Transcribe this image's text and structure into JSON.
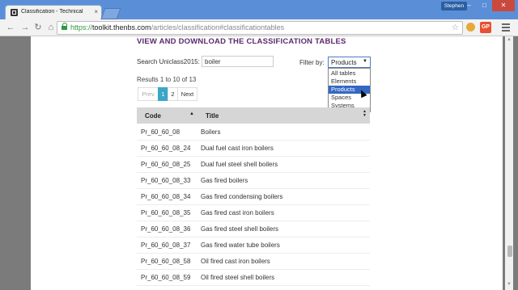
{
  "browser": {
    "tab_title": "Classification - Technical",
    "tab_close": "×",
    "user": "Stephen",
    "url_scheme": "https://",
    "url_host": "toolkit.thenbs.com",
    "url_path": "/articles/classification#classificationtables",
    "ext2_label": "GP",
    "back_icon": "arrow-left",
    "forward_icon": "arrow-right",
    "reload_icon": "reload",
    "home_icon": "home"
  },
  "page": {
    "heading": "VIEW AND DOWNLOAD THE CLASSIFICATION TABLES",
    "search_label": "Search Uniclass2015:",
    "search_value": "boiler",
    "filter_label": "Filter by:",
    "filter_selected": "Products",
    "filter_options": [
      "All tables",
      "Elements",
      "Products",
      "Spaces",
      "Systems"
    ],
    "results_text": "Results 1 to 10 of 13",
    "pager": {
      "prev": "Prev",
      "page1": "1",
      "page2": "2",
      "next": "Next"
    },
    "columns": {
      "code": "Code",
      "title": "Title"
    },
    "rows": [
      {
        "code": "Pr_60_60_08",
        "title": "Boilers"
      },
      {
        "code": "Pr_60_60_08_24",
        "title": "Dual fuel cast iron boilers"
      },
      {
        "code": "Pr_60_60_08_25",
        "title": "Dual fuel steel shell boilers"
      },
      {
        "code": "Pr_60_60_08_33",
        "title": "Gas fired boilers"
      },
      {
        "code": "Pr_60_60_08_34",
        "title": "Gas fired condensing boilers"
      },
      {
        "code": "Pr_60_60_08_35",
        "title": "Gas fired cast iron boilers"
      },
      {
        "code": "Pr_60_60_08_36",
        "title": "Gas fired steel shell boilers"
      },
      {
        "code": "Pr_60_60_08_37",
        "title": "Gas fired water tube boilers"
      },
      {
        "code": "Pr_60_60_08_58",
        "title": "Oil fired cast iron boilers"
      },
      {
        "code": "Pr_60_60_08_59",
        "title": "Oil fired steel shell boilers"
      }
    ]
  },
  "colors": {
    "heading": "#5b2a6e",
    "active_page": "#3aa6c8",
    "selected_option": "#3368c4",
    "titlebar": "#5a8fd8"
  }
}
